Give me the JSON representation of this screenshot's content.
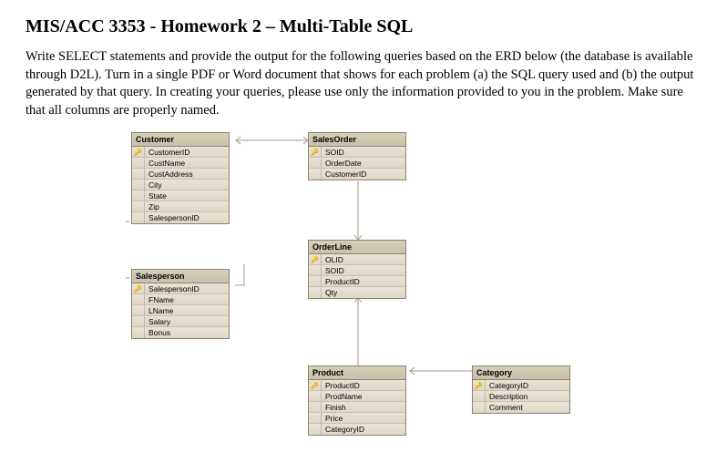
{
  "title": "MIS/ACC 3353 - Homework 2 – Multi-Table SQL",
  "instructions": "Write SELECT statements and provide the output for the following queries based on the ERD below (the database is available through D2L). Turn in a single PDF or Word document that shows for each problem (a) the SQL query used and (b) the output generated by that query. In creating your queries, please use only the information provided to you in the problem. Make sure that all columns are properly named.",
  "entities": {
    "customer": {
      "name": "Customer",
      "fields": [
        {
          "label": "CustomerID",
          "pk": true
        },
        {
          "label": "CustName",
          "pk": false
        },
        {
          "label": "CustAddress",
          "pk": false
        },
        {
          "label": "City",
          "pk": false
        },
        {
          "label": "State",
          "pk": false
        },
        {
          "label": "Zip",
          "pk": false
        },
        {
          "label": "SalespersonID",
          "pk": false
        }
      ]
    },
    "salesorder": {
      "name": "SalesOrder",
      "fields": [
        {
          "label": "SOID",
          "pk": true
        },
        {
          "label": "OrderDate",
          "pk": false
        },
        {
          "label": "CustomerID",
          "pk": false
        }
      ]
    },
    "orderline": {
      "name": "OrderLine",
      "fields": [
        {
          "label": "OLID",
          "pk": true
        },
        {
          "label": "SOID",
          "pk": false
        },
        {
          "label": "ProductID",
          "pk": false
        },
        {
          "label": "Qty",
          "pk": false
        }
      ]
    },
    "salesperson": {
      "name": "Salesperson",
      "fields": [
        {
          "label": "SalespersonID",
          "pk": true
        },
        {
          "label": "FName",
          "pk": false
        },
        {
          "label": "LName",
          "pk": false
        },
        {
          "label": "Salary",
          "pk": false
        },
        {
          "label": "Bonus",
          "pk": false
        }
      ]
    },
    "product": {
      "name": "Product",
      "fields": [
        {
          "label": "ProductID",
          "pk": true
        },
        {
          "label": "ProdName",
          "pk": false
        },
        {
          "label": "Finish",
          "pk": false
        },
        {
          "label": "Price",
          "pk": false
        },
        {
          "label": "CategoryID",
          "pk": false
        }
      ]
    },
    "category": {
      "name": "Category",
      "fields": [
        {
          "label": "CategoryID",
          "pk": true
        },
        {
          "label": "Description",
          "pk": false
        },
        {
          "label": "Comment",
          "pk": false
        }
      ]
    }
  },
  "key_icon": "🔑"
}
